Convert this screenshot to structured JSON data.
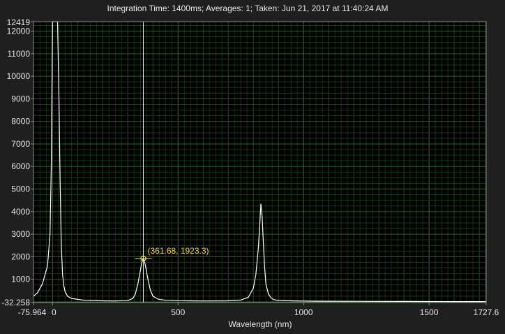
{
  "chart_data": {
    "type": "line",
    "title": "Integration Time: 1400ms;  Averages: 1;  Taken: Jun 21, 2017 at 11:40:24 AM",
    "xlabel": "Wavelength (nm)",
    "ylabel": "",
    "xlim": [
      -75.964,
      1727.6
    ],
    "ylim": [
      -32.258,
      12419
    ],
    "x_ticks": [
      {
        "value": -75.964,
        "label": "-75.964"
      },
      {
        "value": 0,
        "label": "0"
      },
      {
        "value": 500,
        "label": "500"
      },
      {
        "value": 1000,
        "label": "1000"
      },
      {
        "value": 1500,
        "label": "1500"
      },
      {
        "value": 1727.6,
        "label": "1727.6"
      }
    ],
    "y_ticks": [
      {
        "value": -32.258,
        "label": "-32.258"
      },
      {
        "value": 1000,
        "label": "1000"
      },
      {
        "value": 2000,
        "label": "2000"
      },
      {
        "value": 3000,
        "label": "3000"
      },
      {
        "value": 4000,
        "label": "4000"
      },
      {
        "value": 5000,
        "label": "5000"
      },
      {
        "value": 6000,
        "label": "6000"
      },
      {
        "value": 7000,
        "label": "7000"
      },
      {
        "value": 8000,
        "label": "8000"
      },
      {
        "value": 9000,
        "label": "9000"
      },
      {
        "value": 10000,
        "label": "10000"
      },
      {
        "value": 11000,
        "label": "11000"
      },
      {
        "value": 12000,
        "label": "12000"
      },
      {
        "value": 12419,
        "label": "12419"
      }
    ],
    "grid": true,
    "series": [
      {
        "color": "#ffffff",
        "x": [
          -75.964,
          -60,
          -40,
          -20,
          -10,
          -5,
          0,
          4,
          8,
          15,
          20,
          25,
          30,
          35,
          40,
          45,
          50,
          60,
          70,
          80,
          100,
          120,
          150,
          200,
          250,
          300,
          320,
          330,
          340,
          350,
          355,
          358,
          361.68,
          365,
          370,
          380,
          390,
          400,
          420,
          450,
          500,
          550,
          600,
          700,
          750,
          780,
          800,
          810,
          820,
          825,
          830,
          835,
          840,
          845,
          850,
          860,
          870,
          880,
          900,
          950,
          1000,
          1050,
          1100,
          1200,
          1300,
          1400,
          1500,
          1600,
          1700,
          1727.6
        ],
        "y": [
          250,
          400,
          800,
          1600,
          3000,
          6000,
          12419,
          12419,
          12419,
          12419,
          12419,
          9500,
          5500,
          2500,
          1200,
          700,
          450,
          250,
          180,
          140,
          110,
          80,
          60,
          45,
          40,
          55,
          150,
          350,
          800,
          1400,
          1700,
          1850,
          1923.3,
          1850,
          1600,
          1000,
          500,
          250,
          120,
          70,
          50,
          45,
          40,
          45,
          80,
          200,
          600,
          1200,
          2400,
          3300,
          4350,
          3800,
          2600,
          1500,
          800,
          350,
          180,
          100,
          60,
          45,
          35,
          30,
          28,
          25,
          20,
          18,
          15,
          12,
          10,
          8
        ]
      }
    ],
    "cursor": {
      "x": 361.68,
      "y": 1923.3,
      "label": "(361.68, 1923.3)"
    }
  }
}
